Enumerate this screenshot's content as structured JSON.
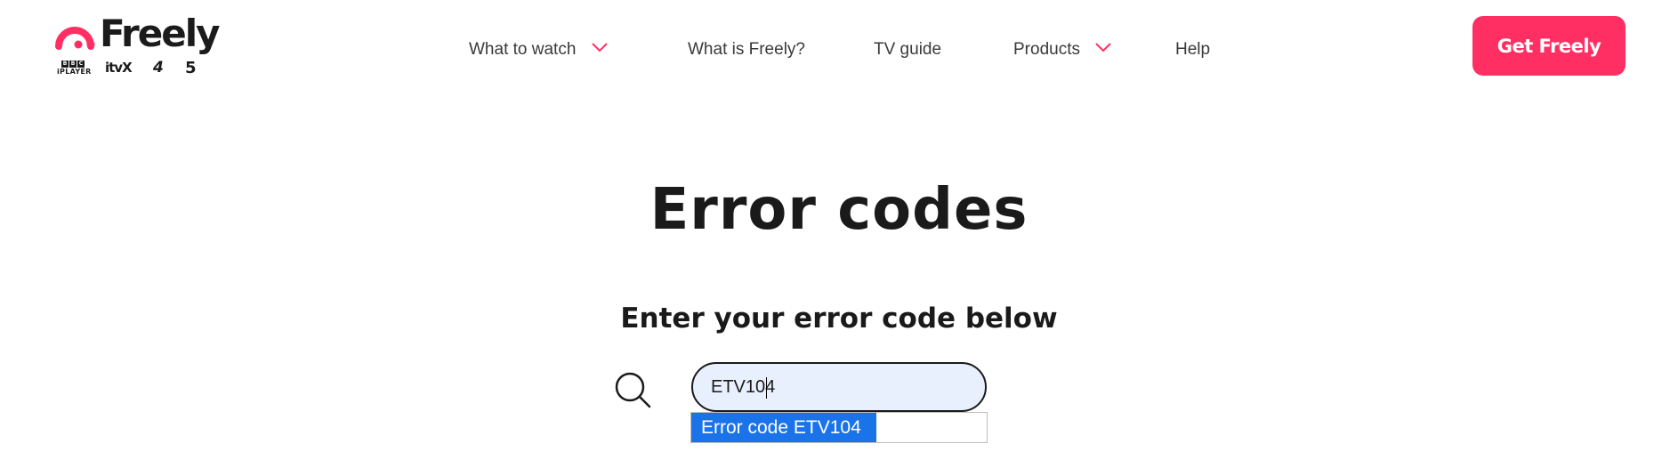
{
  "brand": {
    "name": "Freely",
    "accent": "#ff2f64",
    "partners": {
      "bbc_letters": [
        "B",
        "B",
        "C"
      ],
      "bbc_sub": "iPLAYER",
      "itvx": "itvX",
      "channel4": "4",
      "channel5": "5"
    }
  },
  "nav": {
    "items": [
      {
        "label": "What to watch",
        "has_dropdown": true
      },
      {
        "label": "What is Freely?",
        "has_dropdown": false
      },
      {
        "label": "TV guide",
        "has_dropdown": false
      },
      {
        "label": "Products",
        "has_dropdown": true
      },
      {
        "label": "Help",
        "has_dropdown": false
      }
    ],
    "cta_label": "Get Freely"
  },
  "main": {
    "title": "Error codes",
    "subtitle": "Enter your error code below",
    "search": {
      "value": "ETV104",
      "icon": "search-icon"
    },
    "suggestions": [
      {
        "label": "Error code ETV104",
        "highlight_color": "#1a73e8"
      }
    ]
  }
}
